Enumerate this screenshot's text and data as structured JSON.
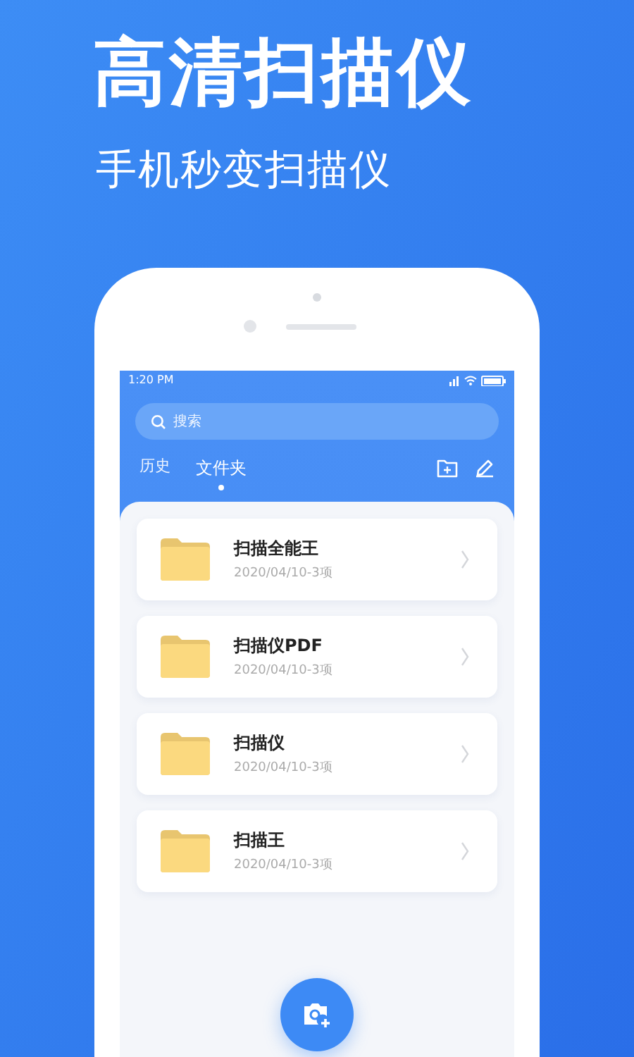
{
  "headline": "高清扫描仪",
  "subheadline": "手机秒变扫描仪",
  "status_bar": {
    "time": "1:20 PM"
  },
  "search": {
    "placeholder": "搜索"
  },
  "tabs": [
    {
      "label": "历史",
      "selected": false
    },
    {
      "label": "文件夹",
      "selected": true
    }
  ],
  "folders": [
    {
      "name": "扫描全能王",
      "meta": "2020/04/10-3项"
    },
    {
      "name": "扫描仪PDF",
      "meta": "2020/04/10-3项"
    },
    {
      "name": "扫描仪",
      "meta": "2020/04/10-3项"
    },
    {
      "name": "扫描王",
      "meta": "2020/04/10-3项"
    }
  ]
}
